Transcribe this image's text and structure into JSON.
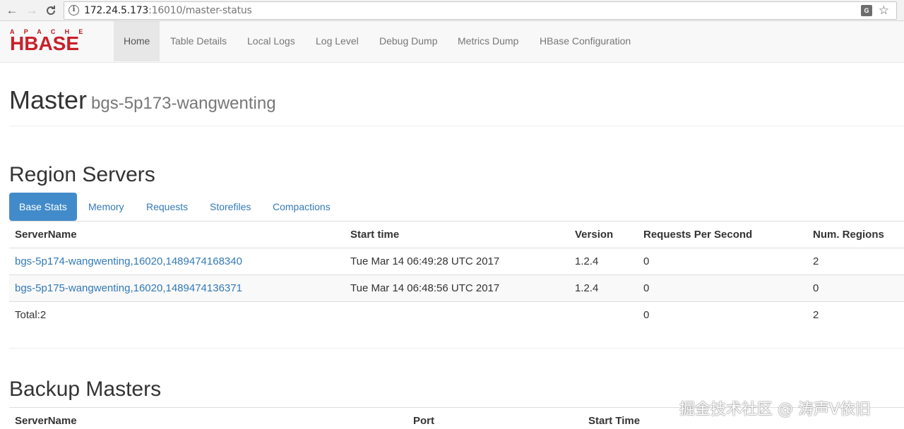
{
  "browser": {
    "back_icon": "←",
    "forward_icon": "→",
    "reload_icon": "C",
    "url_host": "172.24.5.173",
    "url_path": ":16010/master-status",
    "info_icon": "i",
    "translate_icon": "G",
    "star_icon": "☆"
  },
  "navbar": {
    "logo_top": "APACHE",
    "logo_main": "HBASE",
    "items": [
      {
        "label": "Home"
      },
      {
        "label": "Table Details"
      },
      {
        "label": "Local Logs"
      },
      {
        "label": "Log Level"
      },
      {
        "label": "Debug Dump"
      },
      {
        "label": "Metrics Dump"
      },
      {
        "label": "HBase Configuration"
      }
    ]
  },
  "page": {
    "title": "Master",
    "hostname": "bgs-5p173-wangwenting"
  },
  "region_servers": {
    "heading": "Region Servers",
    "tabs": [
      {
        "label": "Base Stats"
      },
      {
        "label": "Memory"
      },
      {
        "label": "Requests"
      },
      {
        "label": "Storefiles"
      },
      {
        "label": "Compactions"
      }
    ],
    "columns": [
      "ServerName",
      "Start time",
      "Version",
      "Requests Per Second",
      "Num. Regions"
    ],
    "rows": [
      {
        "server": "bgs-5p174-wangwenting,16020,1489474168340",
        "start": "Tue Mar 14 06:49:28 UTC 2017",
        "version": "1.2.4",
        "rps": "0",
        "regions": "2"
      },
      {
        "server": "bgs-5p175-wangwenting,16020,1489474136371",
        "start": "Tue Mar 14 06:48:56 UTC 2017",
        "version": "1.2.4",
        "rps": "0",
        "regions": "0"
      }
    ],
    "total": {
      "label": "Total:2",
      "rps": "0",
      "regions": "2"
    }
  },
  "backup_masters": {
    "heading": "Backup Masters",
    "columns": [
      "ServerName",
      "Port",
      "Start Time"
    ]
  },
  "watermark": "掘金技术社区 @ 涛声V依旧"
}
